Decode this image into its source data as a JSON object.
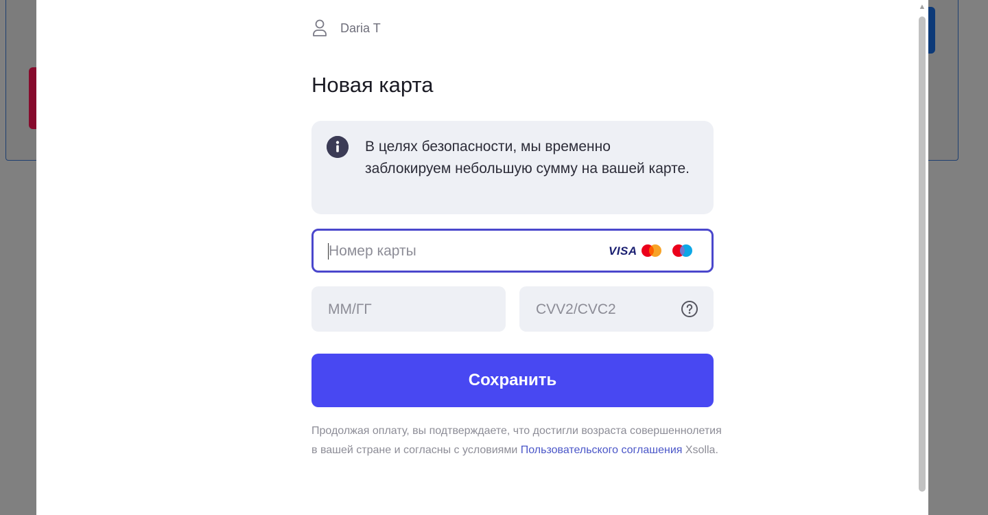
{
  "user": {
    "name": "Daria T",
    "icon": "user-icon"
  },
  "form": {
    "title": "Новая карта",
    "info": {
      "icon": "info-icon",
      "text": "В целях безопасности, мы временно заблокируем небольшую сумму на вашей карте."
    },
    "card_number": {
      "placeholder": "Номер карты",
      "value": ""
    },
    "card_brands": [
      "VISA",
      "mastercard",
      "maestro"
    ],
    "expiry": {
      "placeholder": "ММ/ГГ",
      "value": ""
    },
    "cvv": {
      "placeholder": "CVV2/CVC2",
      "value": "",
      "help_icon": "question-circle-icon"
    },
    "save_label": "Сохранить"
  },
  "legal": {
    "text_before": "Продолжая оплату, вы подтверждаете, что достигли возраста совершеннолетия в вашей стране и согласны с условиями ",
    "link_text": "Пользовательского соглашения",
    "text_after": " Xsolla."
  },
  "colors": {
    "accent": "#4848f2",
    "focus_border": "#4a47cc",
    "field_bg": "#eef0f5",
    "link": "#4a56c8"
  }
}
